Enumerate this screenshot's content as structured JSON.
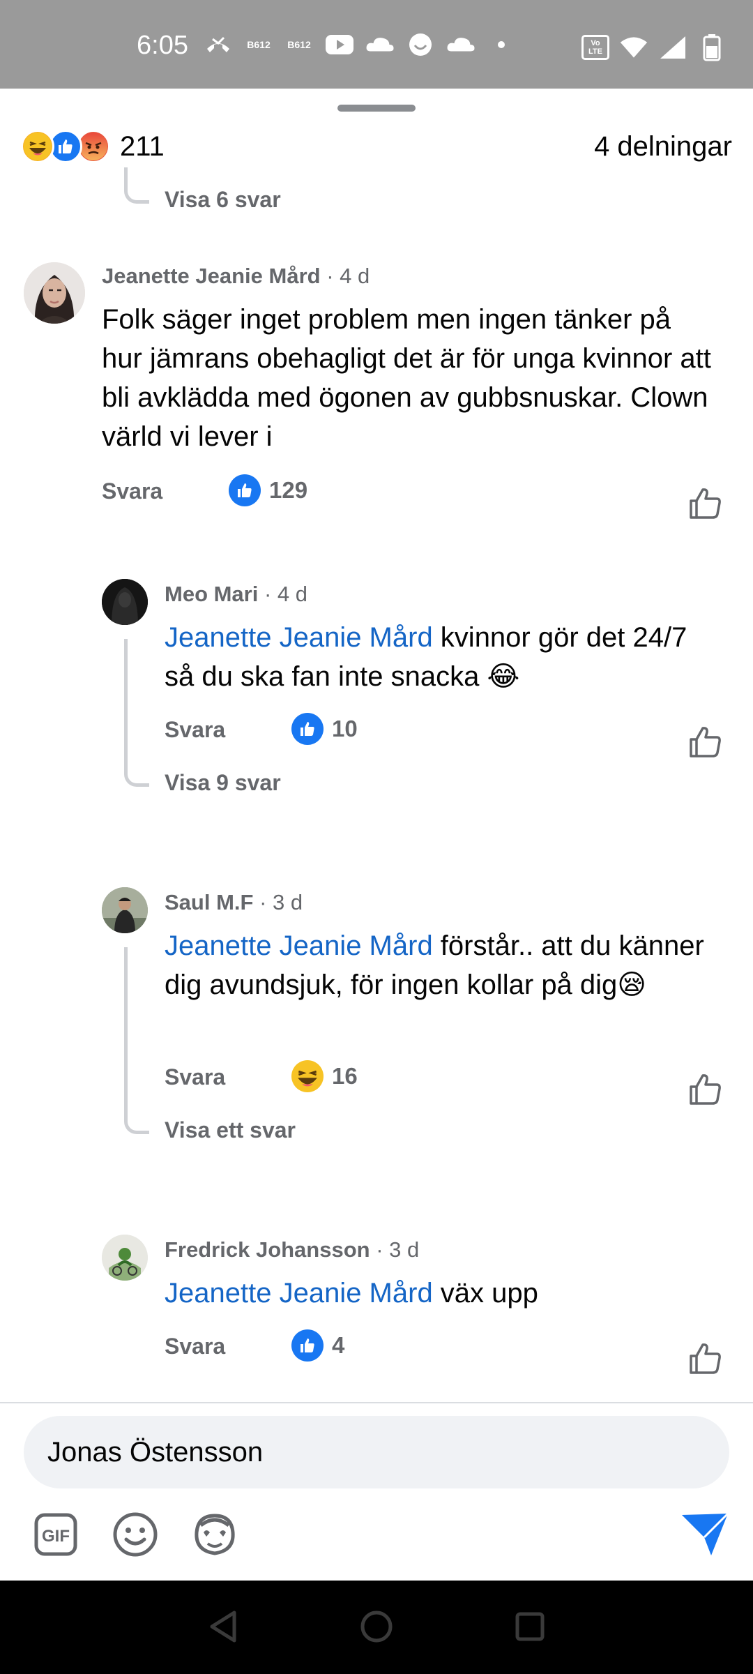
{
  "status_bar": {
    "time": "6:05",
    "left_icons": [
      "missed-call-icon",
      "b612-icon",
      "b612-icon",
      "youtube-icon",
      "klart-icon",
      "smiley-app-icon",
      "klart-icon",
      "dot-icon"
    ],
    "right_icons": [
      "volte-icon",
      "wifi-icon",
      "signal-icon",
      "battery-icon"
    ],
    "volte_label": "Vo LTE"
  },
  "reactions": {
    "count": "211",
    "shares": "4 delningar",
    "icons": [
      "haha-icon",
      "like-icon",
      "angry-icon"
    ]
  },
  "thread": {
    "show_replies_top": "Visa 6 svar",
    "comments": [
      {
        "author": "Jeanette Jeanie Mård",
        "time": "· 4 d",
        "text": "Folk säger inget problem men ingen tänker på hur jämrans obehagligt det är för unga kvinnor att bli avklädda med ögonen av gubbsnuskar. Clown värld vi lever i",
        "reply_label": "Svara",
        "reaction_count": "129",
        "reaction_type": "like"
      },
      {
        "author": "Meo Mari",
        "time": "· 4 d",
        "mention": "Jeanette Jeanie Mård",
        "text": " kvinnor gör det 24/7 så du ska fan inte snacka 😂",
        "reply_label": "Svara",
        "reaction_count": "10",
        "reaction_type": "like",
        "show_replies": "Visa 9 svar"
      },
      {
        "author": "Saul M.F",
        "time": "· 3 d",
        "mention": "Jeanette Jeanie Mård",
        "text": " förstår.. att du känner dig avundsjuk, för ingen kollar på dig😪",
        "reply_label": "Svara",
        "reaction_count": "16",
        "reaction_type": "haha",
        "show_replies": "Visa ett svar"
      },
      {
        "author": "Fredrick Johansson",
        "time": "· 3 d",
        "mention": "Jeanette Jeanie Mård",
        "text": " väx upp",
        "reply_label": "Svara",
        "reaction_count": "4",
        "reaction_type": "like"
      }
    ]
  },
  "composer": {
    "value": "Jonas Östensson",
    "tools": [
      "gif-icon",
      "emoji-icon",
      "avatar-sticker-icon"
    ],
    "gif_label": "GIF"
  },
  "colors": {
    "facebook_blue": "#1877f2",
    "mention_blue": "#1465c6",
    "secondary_text": "#65676b",
    "status_bar_bg": "#9a9a9a"
  }
}
